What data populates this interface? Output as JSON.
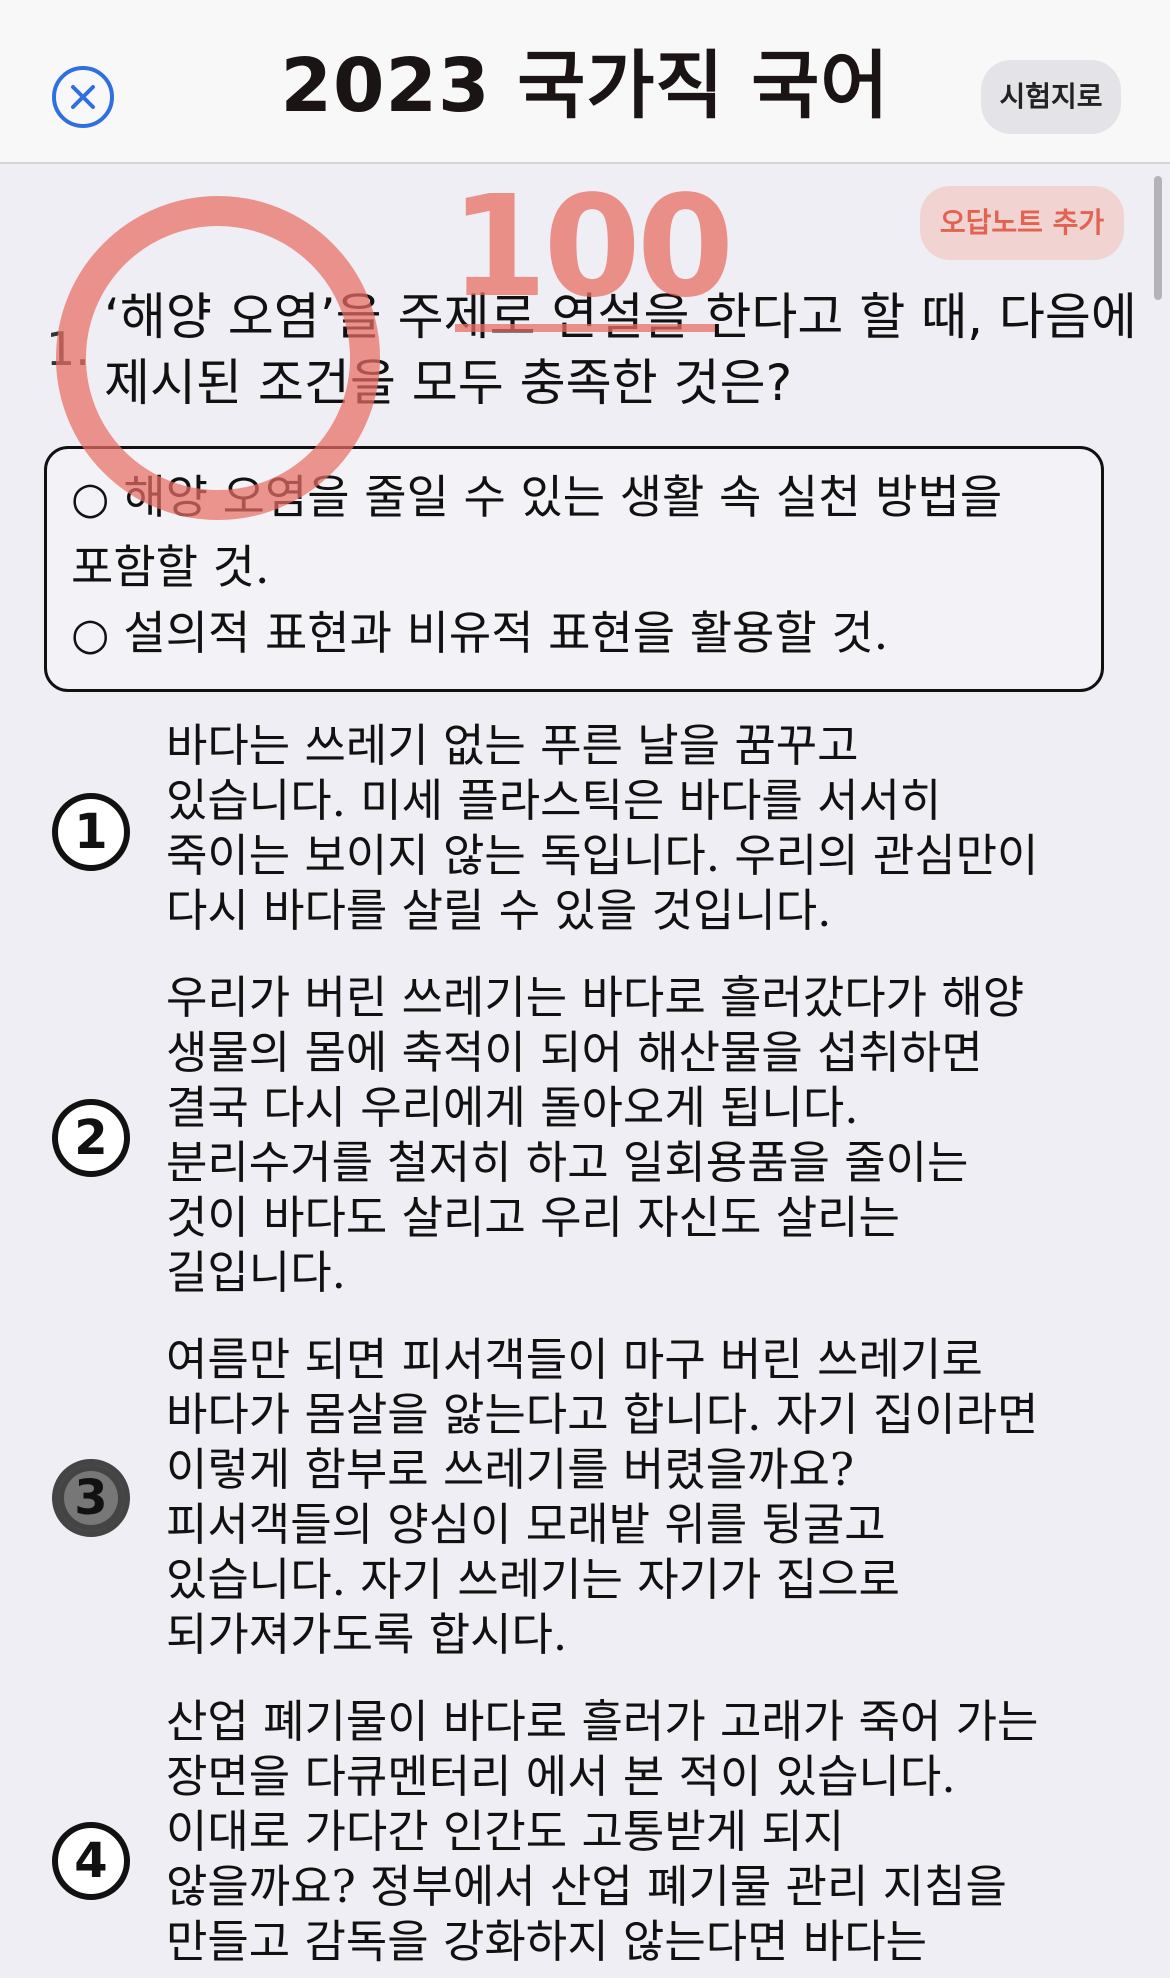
{
  "header": {
    "title": "2023 국가직 국어",
    "exit_label": "시험지로"
  },
  "actions": {
    "wrong_note_label": "오답노트 추가"
  },
  "grade": {
    "score": "100"
  },
  "question": {
    "number": "1.",
    "lines": [
      "‘해양 오염’을 주제로 연설을 한다고 할 때, 다음에",
      "제시된 조건을 모두 충족한 것은?"
    ],
    "conditions": {
      "mark": "○",
      "c1_lines": [
        "해양 오염을 줄일 수 있는 생활 속 실천 방법을",
        "포함할 것."
      ],
      "c2_lines": [
        "설의적 표현과 비유적 표현을 활용할 것."
      ]
    }
  },
  "choices": [
    {
      "num": "1",
      "lines": [
        "바다는 쓰레기 없는 푸른 날을 꿈꾸고",
        "있습니다. 미세 플라스틱은 바다를 서서히",
        "죽이는 보이지 않는 독입니다. 우리의 관심만이",
        "다시 바다를 살릴 수 있을 것입니다."
      ]
    },
    {
      "num": "2",
      "lines": [
        "우리가 버린 쓰레기는 바다로 흘러갔다가 해양",
        "생물의 몸에 축적이 되어 해산물을 섭취하면",
        "결국 다시 우리에게 돌아오게 됩니다.",
        "분리수거를 철저히 하고 일회용품을 줄이는",
        "것이 바다도 살리고 우리 자신도 살리는",
        "길입니다."
      ]
    },
    {
      "num": "3",
      "selected": true,
      "lines": [
        "여름만 되면 피서객들이 마구 버린 쓰레기로",
        "바다가 몸살을 앓는다고 합니다. 자기 집이라면",
        "이렇게 함부로 쓰레기를 버렸을까요?",
        "피서객들의 양심이 모래밭 위를 뒹굴고",
        "있습니다. 자기 쓰레기는 자기가 집으로",
        "되가져가도록 합시다."
      ]
    },
    {
      "num": "4",
      "lines": [
        "산업 폐기물이 바다로 흘러가 고래가 죽어 가는",
        "장면을 다큐멘터리 에서 본 적이 있습니다.",
        "이대로 가다간 인간도 고통받게 되지",
        "않을까요? 정부에서 산업 폐기물 관리 지침을",
        "만들고 감독을 강화하지 않는다면 바다는"
      ]
    }
  ]
}
